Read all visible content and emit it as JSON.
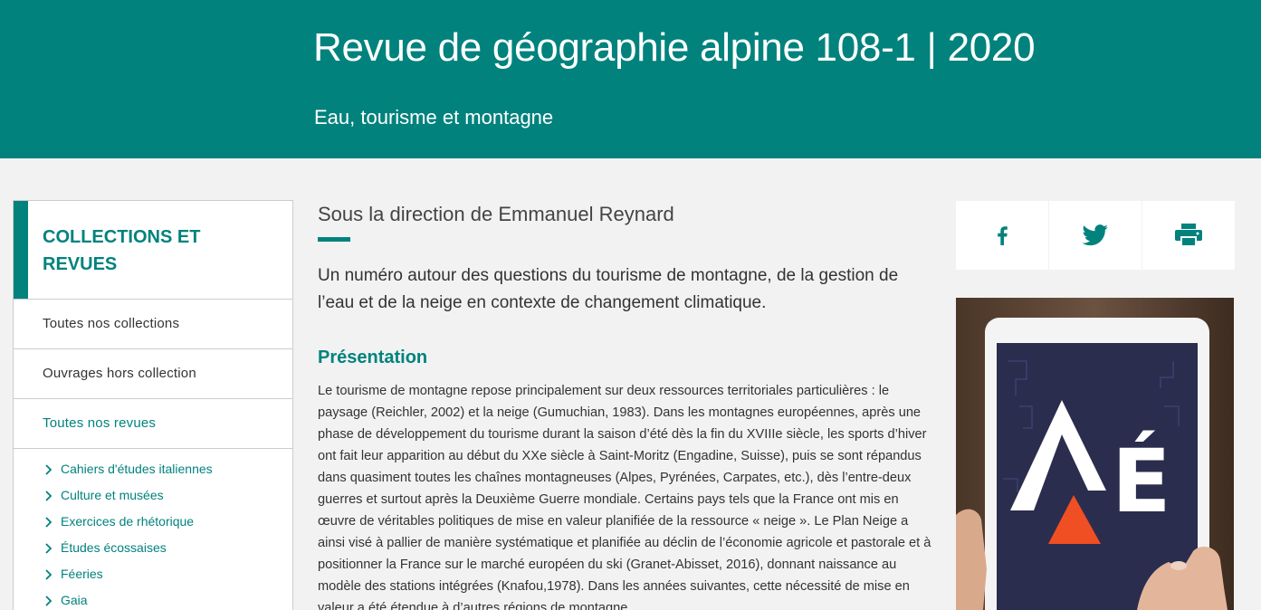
{
  "header": {
    "title": "Revue de géographie alpine 108-1 | 2020",
    "subtitle": "Eau, tourisme et montagne"
  },
  "sidebar": {
    "heading": "COLLECTIONS ET REVUES",
    "links": [
      {
        "label": "Toutes nos collections"
      },
      {
        "label": "Ouvrages hors collection"
      },
      {
        "label": "Toutes nos revues"
      }
    ],
    "journals": [
      {
        "label": "Cahiers d'études italiennes"
      },
      {
        "label": "Culture et musées"
      },
      {
        "label": "Exercices de rhétorique"
      },
      {
        "label": "Études écossaises"
      },
      {
        "label": "Féeries"
      },
      {
        "label": "Gaia"
      }
    ]
  },
  "main": {
    "direction": "Sous la direction de Emmanuel Reynard",
    "lead": "Un numéro autour des questions du tourisme de montagne, de la gestion de l’eau et de la neige en contexte de changement climatique.",
    "section_title": "Présentation",
    "body": "Le tourisme de montagne repose principalement sur deux ressources territoriales particulières : le paysage (Reichler, 2002) et la neige (Gumuchian, 1983). Dans les montagnes européennes, après une phase de développement du tourisme durant la saison d’été dès la fin du XVIIIe siècle, les sports d’hiver ont fait leur apparition au début du XXe siècle à Saint-Moritz (Engadine, Suisse), puis se sont répandus dans quasiment toutes les chaînes montagneuses (Alpes, Pyrénées, Carpates, etc.), dès l’entre-deux guerres et surtout après la Deuxième Guerre mondiale. Certains pays tels que la France ont mis en œuvre de véritables politiques de mise en valeur planifiée de la ressource « neige ». Le Plan Neige a ainsi visé à pallier de manière systématique et planifiée au déclin de l’économie agricole et pastorale et à positionner la France sur le marché européen du ski (Granet-Abisset, 2016), donnant naissance au modèle des stations intégrées (Knafou,1978). Dans les années suivantes, cette nécessité de mise en valeur a été étendue à d’autres régions de montagne"
  },
  "share": [
    {
      "icon": "facebook-icon"
    },
    {
      "icon": "twitter-icon"
    },
    {
      "icon": "print-icon"
    }
  ],
  "promo": {
    "letter": "É"
  },
  "colors": {
    "brand": "#01827d",
    "orange": "#f04e23",
    "navy": "#2b2d4e"
  }
}
